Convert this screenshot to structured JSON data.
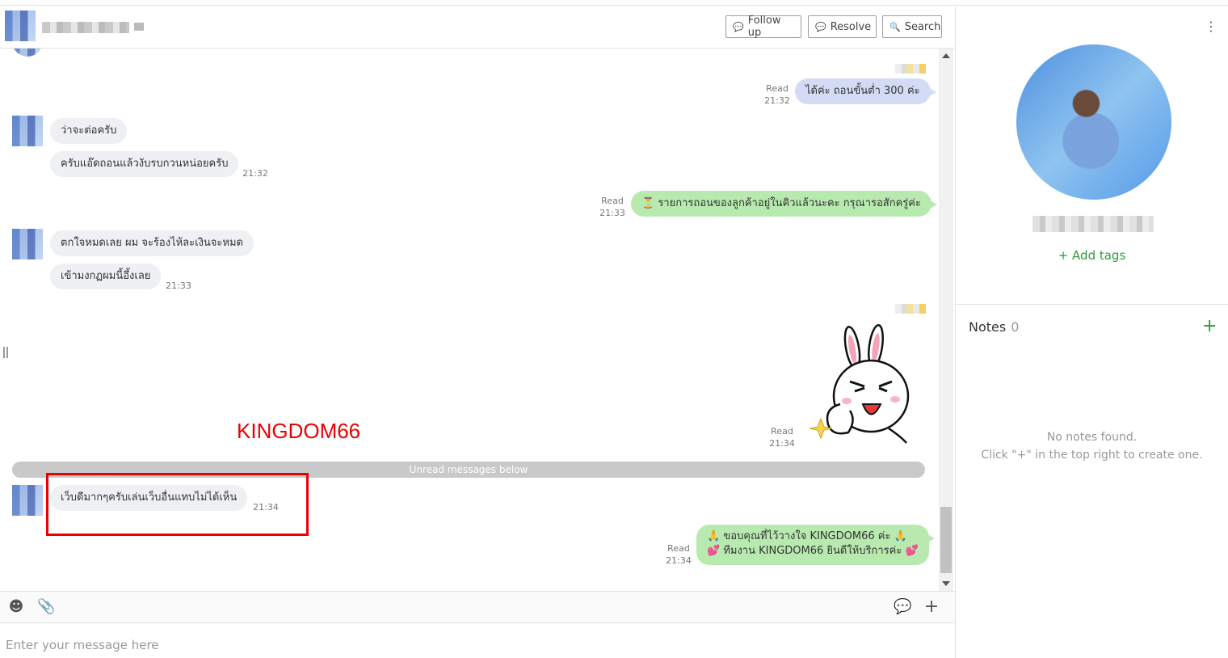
{
  "header": {
    "follow_up_label": "Follow up",
    "resolve_label": "Resolve",
    "search_label": "Search"
  },
  "messages": {
    "m1": {
      "text": "ได้ค่ะ ถอนขั้นต่ำ 300 ค่ะ",
      "status": "Read",
      "time": "21:32"
    },
    "m2": {
      "text": "ว่าจะต่อครับ"
    },
    "m3": {
      "text": "ครับแอ๊ดถอนแล้วงับรบกวนหน่อยครับ",
      "time": "21:32"
    },
    "m4": {
      "text": "⏳ รายการถอนของลูกค้าอยู่ในคิวแล้วนะคะ กรุณารอสักครู่ค่ะ",
      "status": "Read",
      "time": "21:33"
    },
    "m5": {
      "text": "ตกใจหมดเลย ผม จะร้องไห้ละเงินจะหมด"
    },
    "m6": {
      "text": "เข้ามงกฏผมนี้อึ้งเลย",
      "time": "21:33"
    },
    "sticker": {
      "status": "Read",
      "time": "21:34"
    },
    "unread_label": "Unread messages below",
    "m7": {
      "text": "เว็บดีมากๆครับเล่นเว็บอื่นแทบไม่ได้เห็น",
      "time": "21:34"
    },
    "m8": {
      "line1": "🙏 ขอบคุณที่ไว้วางใจ KINGDOM66 ค่ะ 🙏",
      "line2": "💕 ทีมงาน KINGDOM66 ยินดีให้บริการค่ะ 💕",
      "status": "Read",
      "time": "21:34"
    }
  },
  "annotation": {
    "brand": "KINGDOM66"
  },
  "composer": {
    "placeholder": "Enter your message here"
  },
  "sidebar": {
    "add_tags": "+ Add tags",
    "notes_title": "Notes",
    "notes_count": "0",
    "notes_add": "+",
    "empty_line1": "No notes found.",
    "empty_line2": "Click \"+\" in the top right to create one."
  }
}
